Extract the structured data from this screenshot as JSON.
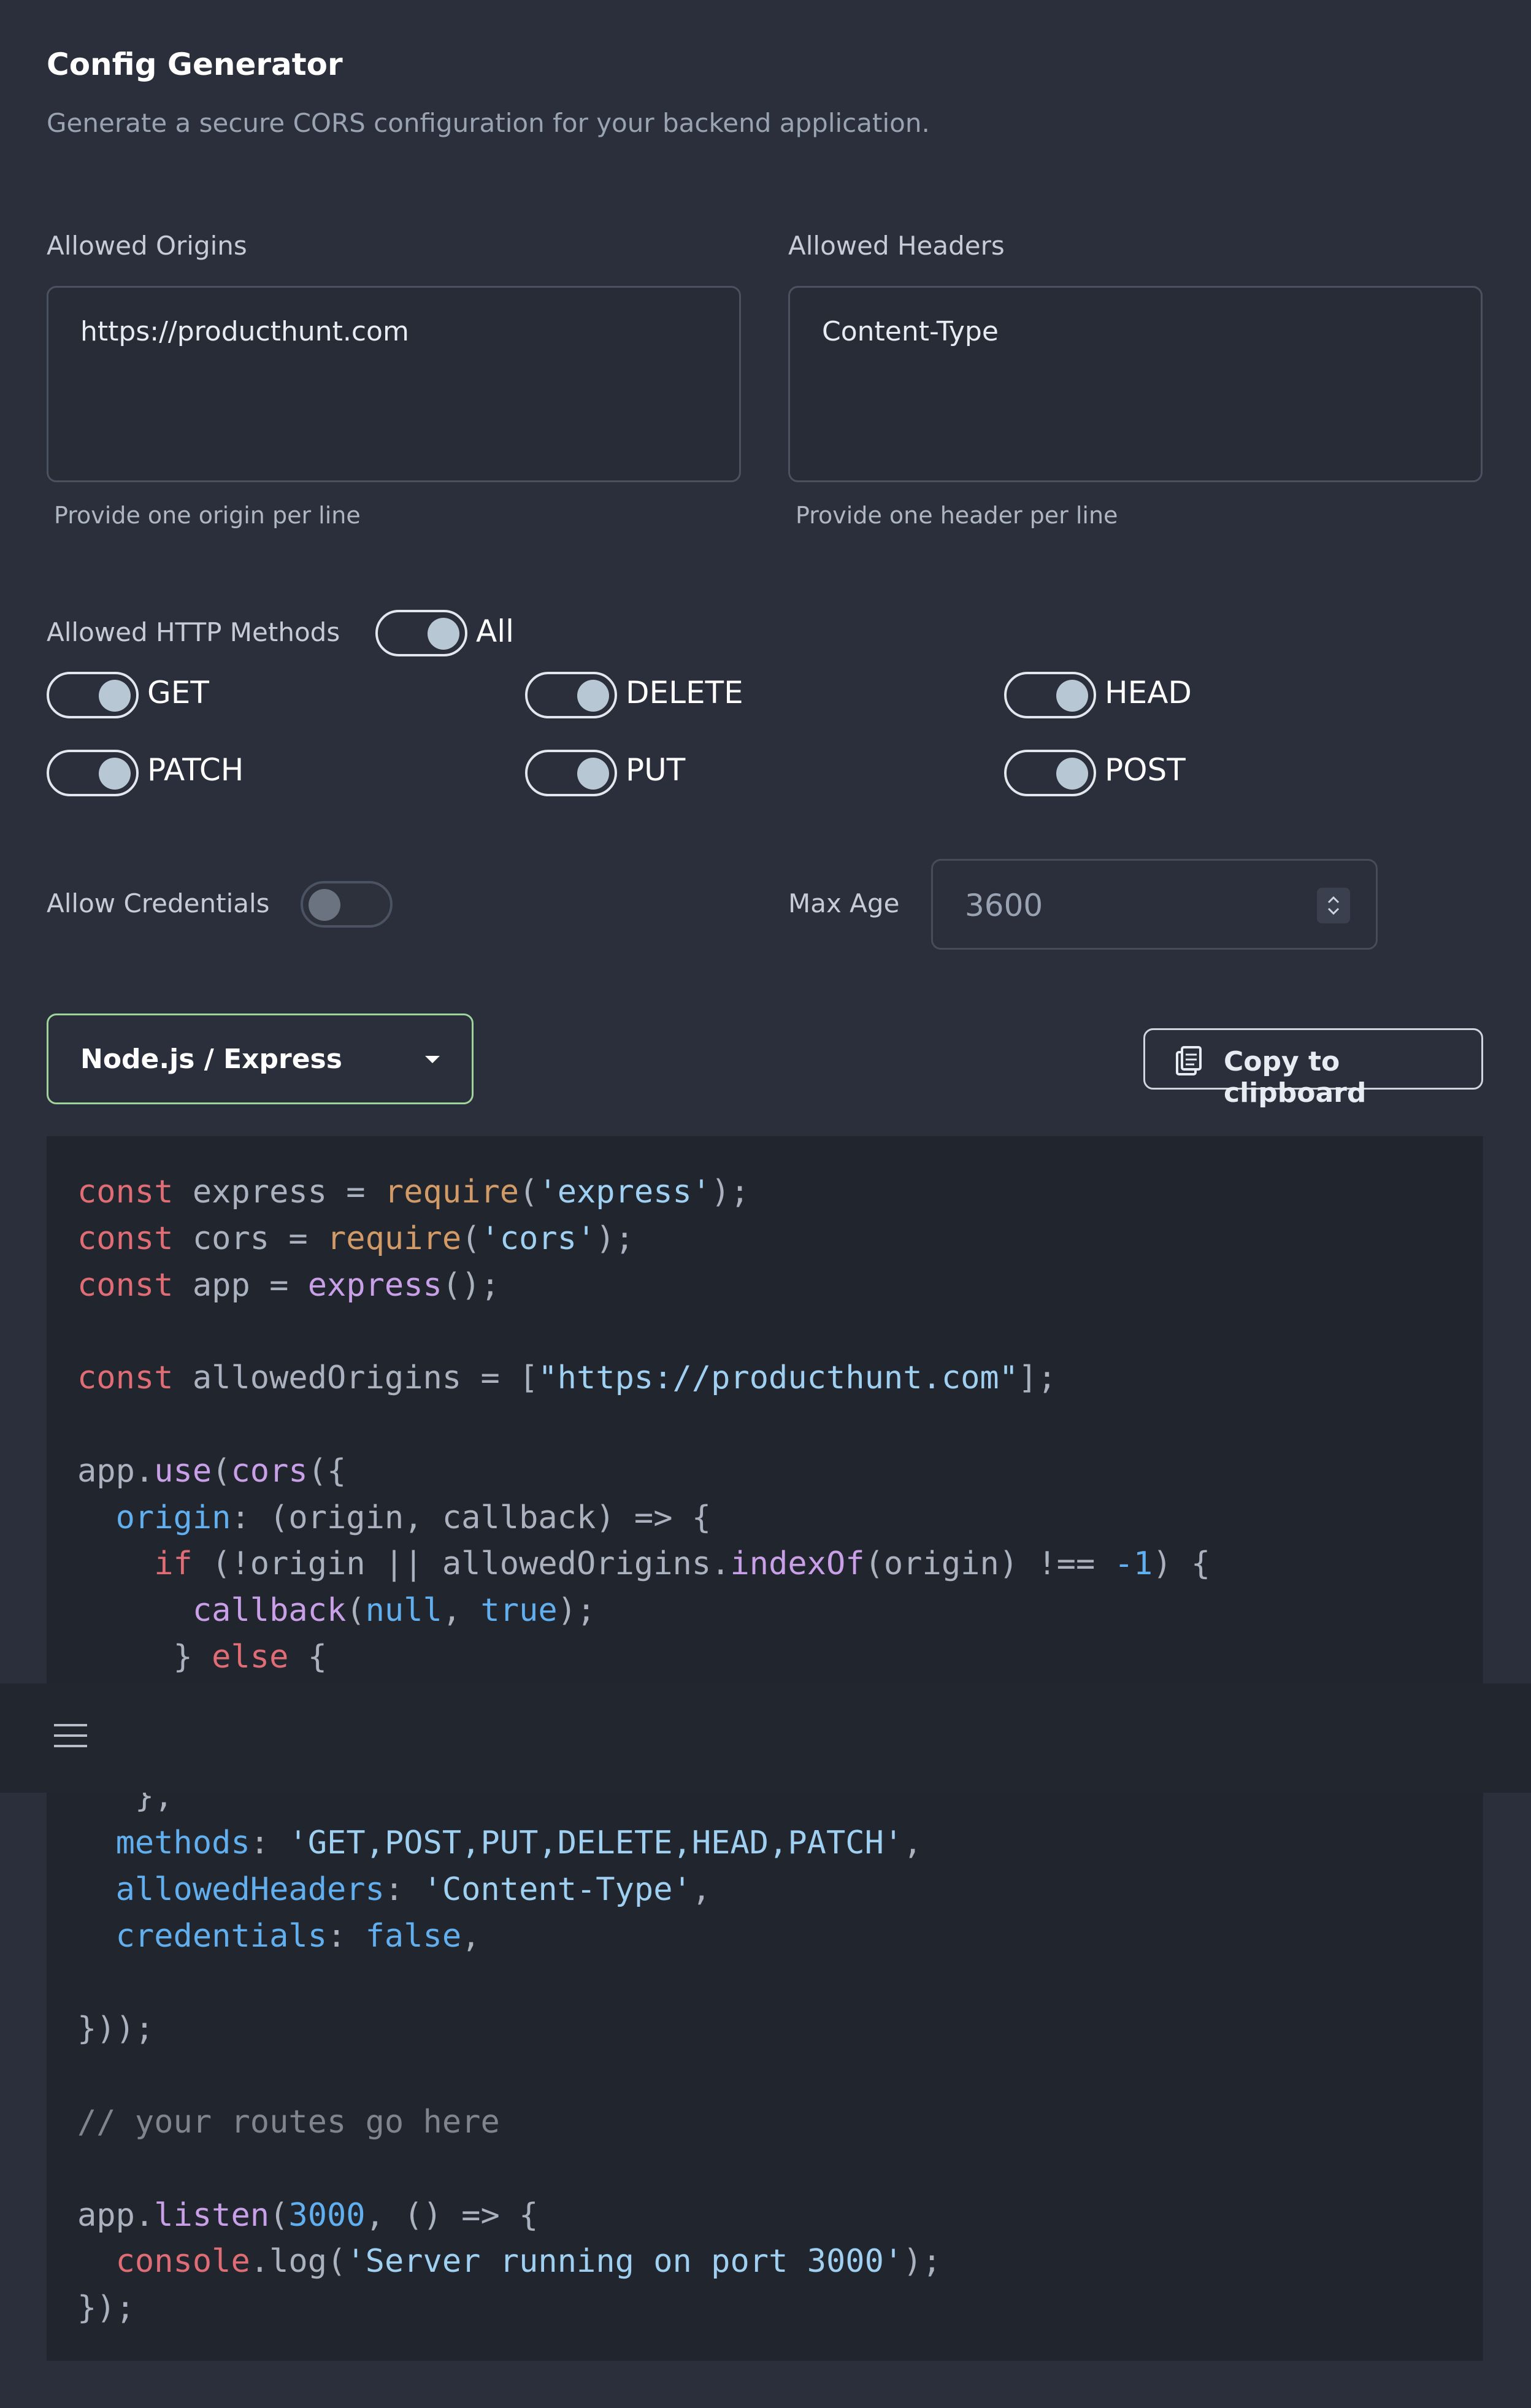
{
  "header": {
    "title": "Config Generator",
    "subtitle": "Generate a secure CORS configuration for your backend application."
  },
  "origins": {
    "label": "Allowed Origins",
    "value": "https://producthunt.com",
    "help": "Provide one origin per line"
  },
  "headers": {
    "label": "Allowed Headers",
    "value": "Content-Type",
    "help": "Provide one header per line"
  },
  "methods": {
    "label": "Allowed HTTP Methods",
    "all_label": "All",
    "all_on": true,
    "items": [
      {
        "label": "GET",
        "on": true
      },
      {
        "label": "DELETE",
        "on": true
      },
      {
        "label": "HEAD",
        "on": true
      },
      {
        "label": "PATCH",
        "on": true
      },
      {
        "label": "PUT",
        "on": true
      },
      {
        "label": "POST",
        "on": true
      }
    ]
  },
  "credentials": {
    "label": "Allow Credentials",
    "on": false
  },
  "max_age": {
    "label": "Max Age",
    "value": "3600"
  },
  "framework": {
    "selected": "Node.js / Express"
  },
  "copy": {
    "label": "Copy to clipboard"
  },
  "code": {
    "l1": {
      "a": "const",
      "b": " express = ",
      "c": "require",
      "d": "(",
      "e": "'express'",
      "f": ");"
    },
    "l2": {
      "a": "const",
      "b": " cors = ",
      "c": "require",
      "d": "(",
      "e": "'cors'",
      "f": ");"
    },
    "l3": {
      "a": "const",
      "b": " app = ",
      "c": "express",
      "d": "();"
    },
    "l5": {
      "a": "const",
      "b": " allowedOrigins = [",
      "c": "\"https://producthunt.com\"",
      "d": "];"
    },
    "l7": {
      "a": "app.",
      "b": "use",
      "c": "(",
      "d": "cors",
      "e": "({"
    },
    "l8": {
      "a": "  ",
      "b": "origin",
      "c": ": (origin, callback) => {"
    },
    "l9": {
      "a": "    ",
      "b": "if",
      "c": " (!origin || allowedOrigins.",
      "d": "indexOf",
      "e": "(origin) !== ",
      "f": "-1",
      "g": ") {"
    },
    "l10": {
      "a": "      ",
      "b": "callback",
      "c": "(",
      "d": "null",
      "e": ", ",
      "f": "true",
      "g": ");"
    },
    "l11": {
      "a": "     } ",
      "b": "else",
      "c": " {"
    },
    "l14": {
      "a": "   },"
    },
    "l15": {
      "a": "  ",
      "b": "methods",
      "c": ": ",
      "d": "'GET,POST,PUT,DELETE,HEAD,PATCH'",
      "e": ","
    },
    "l16": {
      "a": "  ",
      "b": "allowedHeaders",
      "c": ": ",
      "d": "'Content-Type'",
      "e": ","
    },
    "l17": {
      "a": "  ",
      "b": "credentials",
      "c": ": ",
      "d": "false",
      "e": ","
    },
    "l19": {
      "a": "}));"
    },
    "l21": {
      "a": "// your routes go here"
    },
    "l23": {
      "a": "app.",
      "b": "listen",
      "c": "(",
      "d": "3000",
      "e": ", () => {"
    },
    "l24": {
      "a": "  ",
      "b": "console",
      "c": ".log(",
      "d": "'Server running on port 3000'",
      "e": ");"
    },
    "l25": {
      "a": "});"
    }
  }
}
